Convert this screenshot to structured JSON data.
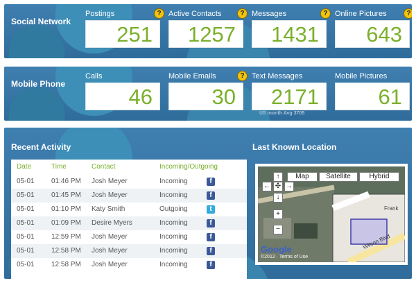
{
  "social": {
    "title": "Social Network",
    "stats": [
      {
        "label": "Postings",
        "value": "251",
        "help": "?"
      },
      {
        "label": "Active Contacts",
        "value": "1257",
        "help": "?"
      },
      {
        "label": "Messages",
        "value": "1431",
        "help": "?"
      },
      {
        "label": "Online Pictures",
        "value": "643",
        "help": "?"
      }
    ]
  },
  "mobile": {
    "title": "Mobile Phone",
    "stats": [
      {
        "label": "Calls",
        "value": "46"
      },
      {
        "label": "Mobile Emails",
        "value": "30",
        "help": "?"
      },
      {
        "label": "Text Messages",
        "value": "2171"
      },
      {
        "label": "Mobile Pictures",
        "value": "61"
      }
    ],
    "text_avg": "US month Avg 3705"
  },
  "activity": {
    "title": "Recent Activity",
    "columns": [
      "Date",
      "Time",
      "Contact",
      "Incoming/Outgoing"
    ],
    "rows": [
      {
        "date": "05-01",
        "time": "01:46 PM",
        "contact": "Josh Meyer",
        "dir": "Incoming",
        "icon": "f"
      },
      {
        "date": "05-01",
        "time": "01:45 PM",
        "contact": "Josh Meyer",
        "dir": "Incoming",
        "icon": "f"
      },
      {
        "date": "05-01",
        "time": "01:10 PM",
        "contact": "Katy Smith",
        "dir": "Outgoing",
        "icon": "t"
      },
      {
        "date": "05-01",
        "time": "01:09 PM",
        "contact": "Desire Myers",
        "dir": "Incoming",
        "icon": "f"
      },
      {
        "date": "05-01",
        "time": "12:59 PM",
        "contact": "Josh Meyer",
        "dir": "Incoming",
        "icon": "f"
      },
      {
        "date": "05-01",
        "time": "12:58 PM",
        "contact": "Josh Meyer",
        "dir": "Incoming",
        "icon": "f"
      },
      {
        "date": "05-01",
        "time": "12:58 PM",
        "contact": "Josh Meyer",
        "dir": "Incoming",
        "icon": "f"
      }
    ]
  },
  "location": {
    "title": "Last Known Location",
    "buttons": {
      "map": "Map",
      "satellite": "Satellite",
      "hybrid": "Hybrid"
    },
    "zoom_in": "+",
    "zoom_out": "−",
    "street1": "Wilson Blvd",
    "street2": "Frank",
    "copyright": "©2012 · Terms of Use",
    "logo": "Google"
  }
}
